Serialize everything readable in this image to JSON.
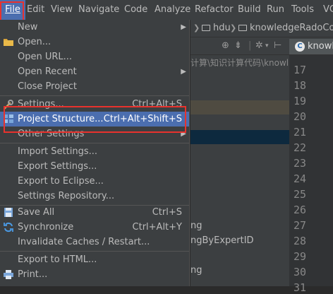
{
  "menubar": {
    "items": [
      "File",
      "Edit",
      "View",
      "Navigate",
      "Code",
      "Analyze",
      "Refactor",
      "Build",
      "Run",
      "Tools",
      "VC"
    ]
  },
  "breadcrumb": {
    "folder1": "hdu",
    "folder2": "knowledgeRadoCon"
  },
  "editor": {
    "tab_label": "knowl",
    "tab_icon": "C",
    "line_numbers": [
      "17",
      "18",
      "19",
      "20",
      "21",
      "22",
      "23",
      "24",
      "25",
      "26",
      "27",
      "28",
      "29",
      "30",
      "31"
    ]
  },
  "project_panel": {
    "path": "计算\\知识计算代码\\knowl",
    "fragment1": "ng",
    "fragment2": "ngByExpertID",
    "fragment3": "ng"
  },
  "file_menu": {
    "new": "New",
    "open": "Open...",
    "open_url": "Open URL...",
    "open_recent": "Open Recent",
    "close_project": "Close Project",
    "settings": "Settings...",
    "settings_shortcut": "Ctrl+Alt+S",
    "project_structure": "Project Structure...",
    "project_structure_shortcut": "Ctrl+Alt+Shift+S",
    "other_settings": "Other Settings",
    "import_settings": "Import Settings...",
    "export_settings": "Export Settings...",
    "export_eclipse": "Export to Eclipse...",
    "settings_repository": "Settings Repository...",
    "save_all": "Save All",
    "save_all_shortcut": "Ctrl+S",
    "synchronize": "Synchronize",
    "synchronize_shortcut": "Ctrl+Alt+Y",
    "invalidate_caches": "Invalidate Caches / Restart...",
    "export_html": "Export to HTML...",
    "print": "Print..."
  },
  "colors": {
    "highlight": "#4b6eaf",
    "annotation_box": "#e8322d",
    "background": "#2b2b2b"
  }
}
